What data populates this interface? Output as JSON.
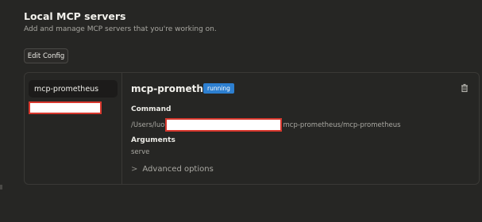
{
  "header": {
    "title": "Local MCP servers",
    "subtitle": "Add and manage MCP servers that you're working on.",
    "edit_config_label": "Edit Config"
  },
  "sidebar": {
    "items": [
      {
        "label": "mcp-prometheus",
        "selected": true
      }
    ]
  },
  "server": {
    "name": "mcp-prometheus",
    "status": "running",
    "command_label": "Command",
    "command_prefix": "/Users/luo",
    "command_suffix": "mcp-prometheus/mcp-prometheus",
    "arguments_label": "Arguments",
    "arguments_value": "serve",
    "advanced_label": "Advanced options"
  },
  "colors": {
    "background": "#262624",
    "status_badge": "#2d7fd0",
    "redaction_border": "#d7372d"
  },
  "icons": {
    "delete": "trash-icon",
    "advanced": "chevron-right-icon"
  }
}
